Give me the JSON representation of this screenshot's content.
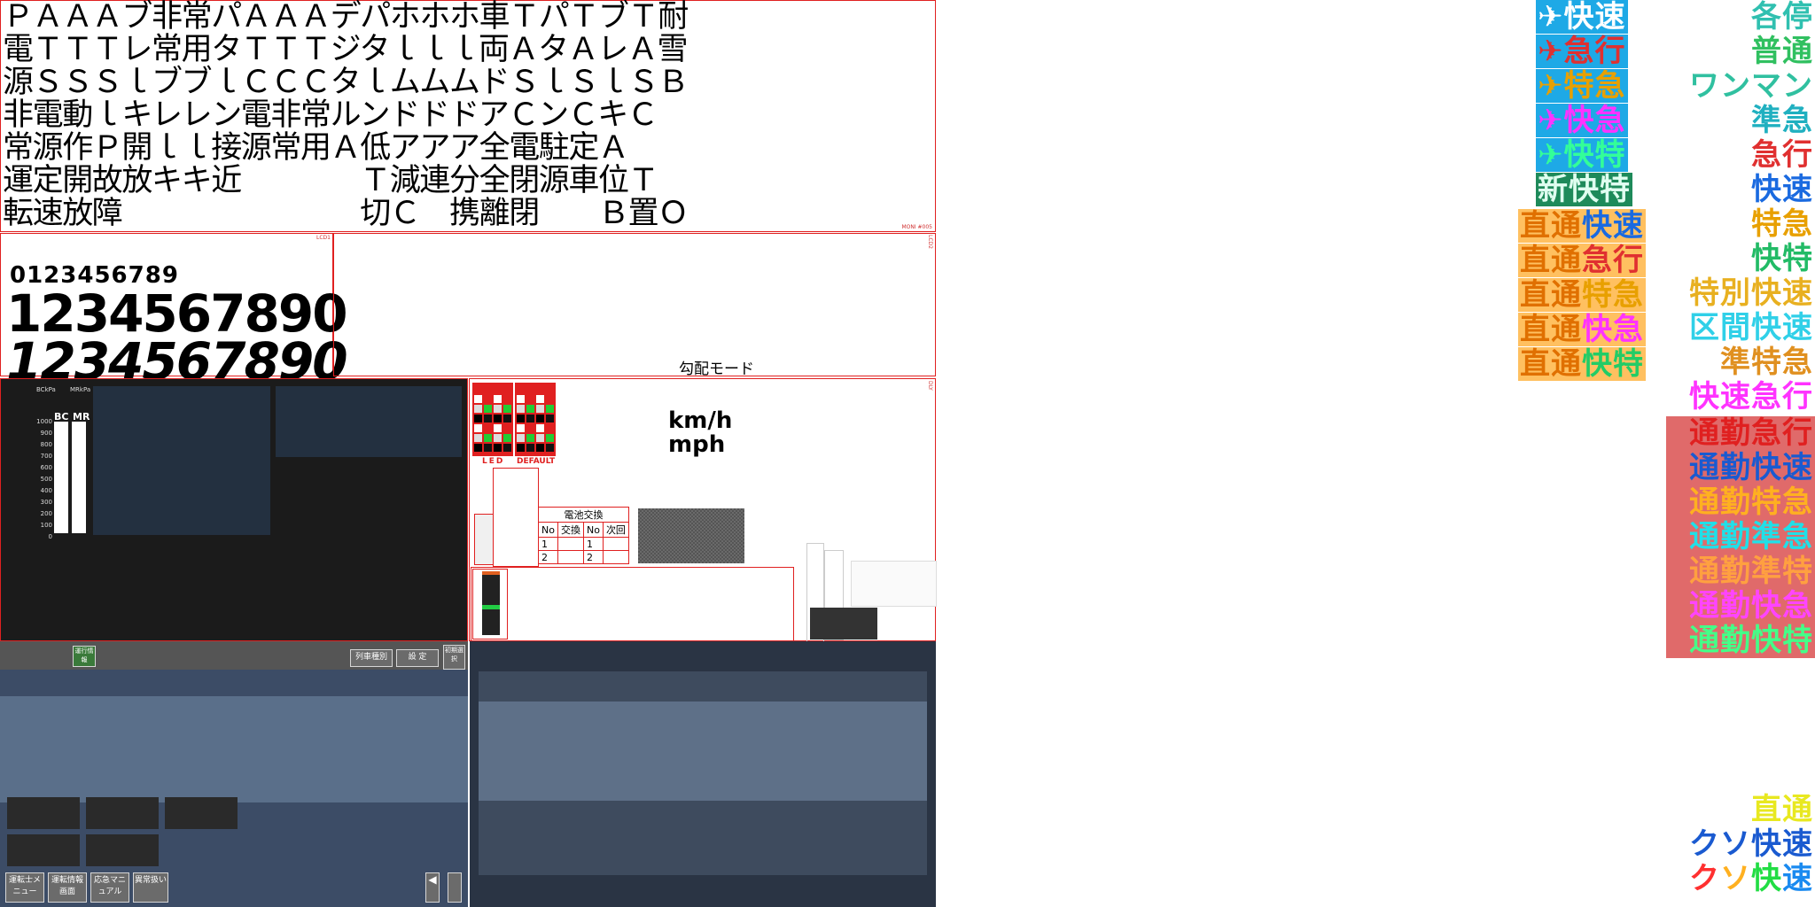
{
  "glyph_sheet": {
    "rows": [
      "ＰＡＡＡブ非常パＡＡＡデパホホホ車ＴパＴブＴ耐",
      "電ＴＴＴレ常用タＴＴＴジタｌｌｌ両ＡタＡレＡ雪",
      "源ＳＳＳｌブブｌＣＣＣタｌムムムドＳｌＳｌＳＢ",
      "非電動ｌキレレン電非常ルンドドドアＣンＣキＣ",
      "常源作Ｐ開ｌｌ接源常用Ａ低アアア全電駐定Ａ",
      "運定開故放キキ近　　　　Ｔ減連分全閉源車位Ｔ",
      "転速放障　　　　　　　　切Ｃ　携離閉　　Ｂ置Ｏ"
    ],
    "corner_label": "MONI #005"
  },
  "digits": {
    "small": "0123456789",
    "large": "1234567890",
    "italic": "1234567890",
    "lcd_label": "LCD1"
  },
  "lcd": {
    "grade_mode": "勾配モード",
    "side_label": "LCD2"
  },
  "meter": {
    "bc_unit": "BCkPa",
    "mr_unit": "MRkPa",
    "bc": "BC",
    "mr": "MR",
    "scale": [
      "1000",
      "900",
      "800",
      "700",
      "600",
      "500",
      "400",
      "300",
      "200",
      "100",
      "0"
    ]
  },
  "misc": {
    "led_label": "LED",
    "default_label": "DEFAULT",
    "speed_units": [
      "km/h",
      "mph"
    ],
    "battery": {
      "title": "電池交換",
      "headers": [
        "No",
        "交換",
        "No",
        "次回"
      ],
      "rows": [
        [
          "1",
          "",
          "1",
          ""
        ],
        [
          "2",
          "",
          "2",
          ""
        ]
      ]
    }
  },
  "menu": {
    "top_button": "運行情報",
    "right_buttons": [
      "列車種別",
      "設 定",
      "初期選択"
    ],
    "bottom_buttons": [
      "運転士メニュー",
      "運転情報画面",
      "応急マニュアル",
      "異常扱い"
    ],
    "arrow": "◀"
  },
  "train_types_left": [
    {
      "text": "✈快速",
      "color": "#ffffff",
      "bg": "#1ea9e6"
    },
    {
      "text": "✈急行",
      "color": "#e03030",
      "bg": "#1ea9e6"
    },
    {
      "text": "✈特急",
      "color": "#e8a000",
      "bg": "#1ea9e6"
    },
    {
      "text": "✈快急",
      "color": "#ff33ff",
      "bg": "#1ea9e6"
    },
    {
      "text": "✈快特",
      "color": "#33ff99",
      "bg": "#1ea9e6"
    },
    {
      "text": "新快特",
      "color": "#e0fff0",
      "bg": "#1e8a5a"
    }
  ],
  "train_types_direct": [
    {
      "text": "直通快速",
      "c1": "#e07000",
      "c2": "#1a6ae0"
    },
    {
      "text": "直通急行",
      "c1": "#e07000",
      "c2": "#e03030"
    },
    {
      "text": "直通特急",
      "c1": "#e07000",
      "c2": "#e8a000"
    },
    {
      "text": "直通快急",
      "c1": "#e07000",
      "c2": "#ff33ff"
    },
    {
      "text": "直通快特",
      "c1": "#e07000",
      "c2": "#22cc66"
    }
  ],
  "train_types_right": [
    {
      "text": "各停",
      "color": "#30c0b0"
    },
    {
      "text": "普通",
      "color": "#30c060"
    },
    {
      "text": "ワンマン",
      "color": "#30c0a0"
    },
    {
      "text": "準急",
      "color": "#20b0c0"
    },
    {
      "text": "急行",
      "color": "#e03030"
    },
    {
      "text": "快速",
      "color": "#1a6ae0"
    },
    {
      "text": "特急",
      "color": "#e8a000"
    },
    {
      "text": "快特",
      "color": "#22bb66"
    },
    {
      "text": "特別快速",
      "color": "#e8b020"
    },
    {
      "text": "区間快速",
      "color": "#30d0e8"
    },
    {
      "text": "準特急",
      "color": "#e09020"
    },
    {
      "text": "快速急行",
      "color": "#ff33ff"
    }
  ],
  "train_types_commute": [
    {
      "text": "通勤急行",
      "color": "#e02020"
    },
    {
      "text": "通勤快速",
      "color": "#1a5ad0"
    },
    {
      "text": "通勤特急",
      "color": "#ffb020"
    },
    {
      "text": "通勤準急",
      "color": "#20e0e8"
    },
    {
      "text": "通勤準特",
      "color": "#ffa040"
    },
    {
      "text": "通勤快急",
      "color": "#ff44ff"
    },
    {
      "text": "通勤快特",
      "color": "#44ff88"
    }
  ],
  "train_types_bottom": [
    {
      "text": "直通",
      "color": "#e8e820"
    },
    {
      "text": "クソ快速",
      "color": "#1a5ad0"
    },
    {
      "text": "クソ快速",
      "color": "rainbow"
    }
  ]
}
